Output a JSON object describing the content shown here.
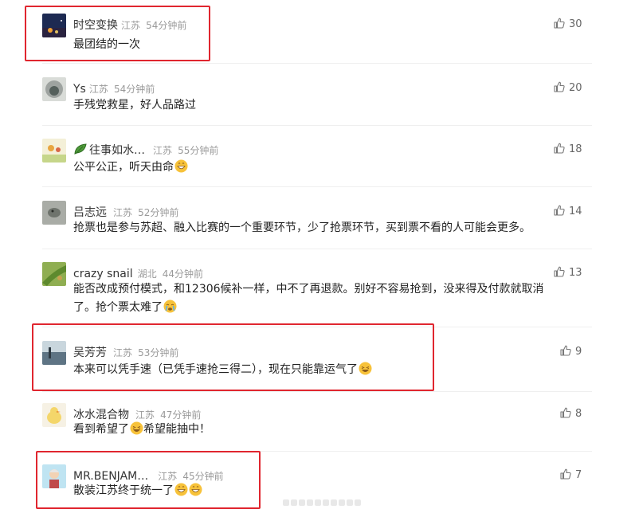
{
  "comments": [
    {
      "user": "时空变换",
      "loc": "江苏",
      "time": "54分钟前",
      "text": "最团结的一次",
      "likes": "30",
      "avatar": "night-city-avatar"
    },
    {
      "user": "Ys",
      "loc": "江苏",
      "time": "54分钟前",
      "text": "手残党救星，好人品路过",
      "likes": "20",
      "avatar": "gray-fluffy-avatar"
    },
    {
      "user": "往事如水…",
      "loc": "江苏",
      "time": "55分钟前",
      "text": "公平公正，听天由命",
      "likes": "18",
      "avatar": "flower-avatar",
      "badge": "leaf-icon"
    },
    {
      "user": "吕志远",
      "loc": "江苏",
      "time": "52分钟前",
      "text": "抢票也是参与苏超、融入比赛的一个重要环节，少了抢票环节，买到票不看的人可能会更多。",
      "likes": "14",
      "avatar": "gray-animal-avatar"
    },
    {
      "user": "crazy snail",
      "loc": "湖北",
      "time": "44分钟前",
      "text_line1": "能否改成预付模式，和12306候补一样，中不了再退款。别好不容易抢到，没来得及付款就取消",
      "text_line2": "了。抢个票太难了",
      "likes": "13",
      "avatar": "green-leaf-avatar"
    },
    {
      "user": "吴芳芳",
      "loc": "江苏",
      "time": "53分钟前",
      "text": "本来可以凭手速（已凭手速抢三得二），现在只能靠运气了",
      "likes": "9",
      "avatar": "lake-avatar"
    },
    {
      "user": "冰水混合物",
      "loc": "江苏",
      "time": "47分钟前",
      "text_a": "看到希望了",
      "text_b": "希望能抽中！",
      "likes": "8",
      "avatar": "duck-avatar"
    },
    {
      "user": "MR.BENJAM…",
      "loc": "江苏",
      "time": "45分钟前",
      "text": "散装江苏终于统一了",
      "likes": "7",
      "avatar": "cartoon-person-avatar"
    }
  ],
  "colors": {
    "highlight": "#e0262f",
    "emoji": "#f7c23a",
    "meta": "#9a9a9a"
  }
}
